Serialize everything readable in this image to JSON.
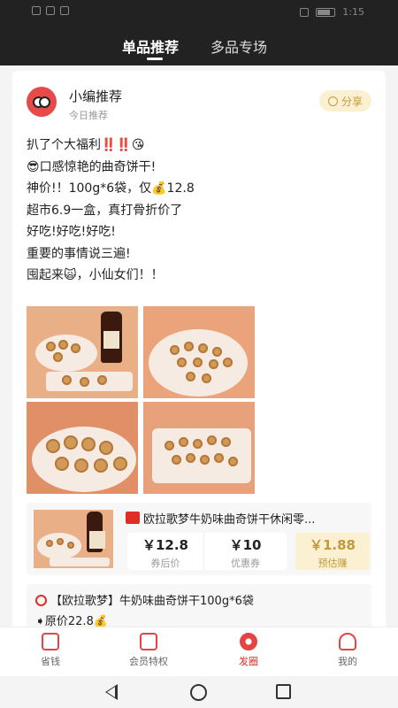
{
  "status_bar": {
    "time": "1:15"
  },
  "top_tabs": [
    {
      "label": "单品推荐",
      "active": true
    },
    {
      "label": "多品专场",
      "active": false
    }
  ],
  "post": {
    "author": "小编推荐",
    "subtitle": "今日推荐",
    "share_label": "分享",
    "lines": [
      "扒了个大福利‼️‼️😘",
      "😎口感惊艳的曲奇饼干!",
      "神价!！100g*6袋，仅💰12.8",
      "超市6.9一盒，真打骨折价了",
      "好吃!好吃!好吃!",
      "重要的事情说三遍!",
      "囤起来🙀，小仙女们！！"
    ]
  },
  "product": {
    "title": "欧拉歌梦牛奶味曲奇饼干休闲零...",
    "prices": [
      {
        "value": "￥12.8",
        "label": "券后价"
      },
      {
        "value": "￥10",
        "label": "优惠券"
      },
      {
        "value": "￥1.88",
        "label": "预估赚"
      }
    ]
  },
  "promo": {
    "line1": "【欧拉歌梦】牛奶味曲奇饼干100g*6袋",
    "line2": "➧原价22.8💰"
  },
  "bottom_nav": [
    {
      "label": "省钱",
      "icon": "home-icon"
    },
    {
      "label": "会员特权",
      "icon": "vip-icon"
    },
    {
      "label": "发圈",
      "icon": "camera-icon",
      "active": true
    },
    {
      "label": "我的",
      "icon": "user-icon"
    }
  ],
  "colors": {
    "accent": "#e02e24",
    "gold": "#c29a3a",
    "gold_bg": "#fbf0d2",
    "dark_header": "#222222"
  }
}
